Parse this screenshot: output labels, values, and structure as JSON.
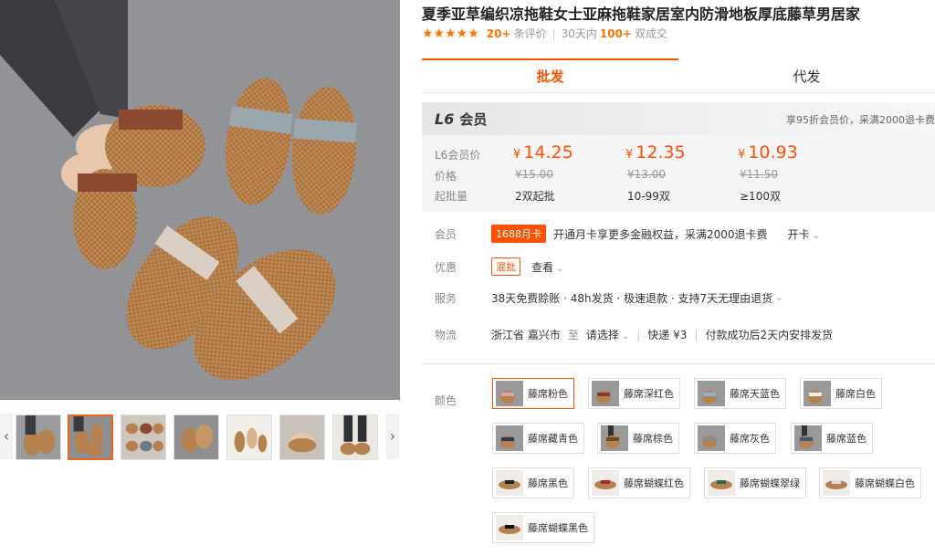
{
  "product": {
    "title": "夏季亚草编织凉拖鞋女士亚麻拖鞋家居室内防滑地板厚底藤草男居家",
    "stars": "★★★★★",
    "review_count": "20+",
    "review_label": "条评价",
    "deals_prefix": "30天内",
    "deals_count": "100+",
    "deals_label": "双成交"
  },
  "thumbnails": {
    "left_arrow": "‹",
    "right_arrow": "›",
    "count": 7,
    "active_index": 1
  },
  "tabs": [
    {
      "label": "批发",
      "active": true
    },
    {
      "label": "代发",
      "active": false
    }
  ],
  "member": {
    "level": "L6",
    "label": "会员",
    "promo": "享95折会员价，采满2000退卡费"
  },
  "pricing": {
    "member_price_label": "L6会员价",
    "price_label": "价格",
    "moq_label": "起批量",
    "tiers": [
      {
        "member_price": "14.25",
        "original": "¥15.00",
        "moq": "2双起批"
      },
      {
        "member_price": "12.35",
        "original": "¥13.00",
        "moq": "10-99双"
      },
      {
        "member_price": "10.93",
        "original": "¥11.50",
        "moq": "≥100双"
      }
    ],
    "currency": "¥"
  },
  "rows": {
    "membership": {
      "label": "会员",
      "badge": "1688月卡",
      "text": "开通月卡享更多金融权益，采满2000退卡费",
      "action": "开卡"
    },
    "discount": {
      "label": "优惠",
      "badge": "混批",
      "action": "查看"
    },
    "service": {
      "label": "服务",
      "text": "38天免费赊账 · 48h发货 · 极速退款 · 支持7天无理由退货"
    },
    "logistics": {
      "label": "物流",
      "origin": "浙江省 嘉兴市",
      "to": "至",
      "dest": "请选择",
      "shipping": "快递 ¥3",
      "dispatch": "付款成功后2天内安排发货"
    }
  },
  "colors": {
    "label": "颜色",
    "options": [
      {
        "name": "藤席粉色",
        "selected": true
      },
      {
        "name": "藤席深红色",
        "selected": false
      },
      {
        "name": "藤席天蓝色",
        "selected": false
      },
      {
        "name": "藤席白色",
        "selected": false
      },
      {
        "name": "藤席藏青色",
        "selected": false
      },
      {
        "name": "藤席棕色",
        "selected": false
      },
      {
        "name": "藤席灰色",
        "selected": false
      },
      {
        "name": "藤席蓝色",
        "selected": false
      },
      {
        "name": "藤席黑色",
        "selected": false
      },
      {
        "name": "藤席蝴蝶红色",
        "selected": false
      },
      {
        "name": "藤席蝴蝶翠绿",
        "selected": false
      },
      {
        "name": "藤席蝴蝶白色",
        "selected": false
      },
      {
        "name": "藤席蝴蝶黑色",
        "selected": false
      }
    ]
  },
  "theme": {
    "accent": "#ff5000",
    "star": "#ff7300"
  }
}
